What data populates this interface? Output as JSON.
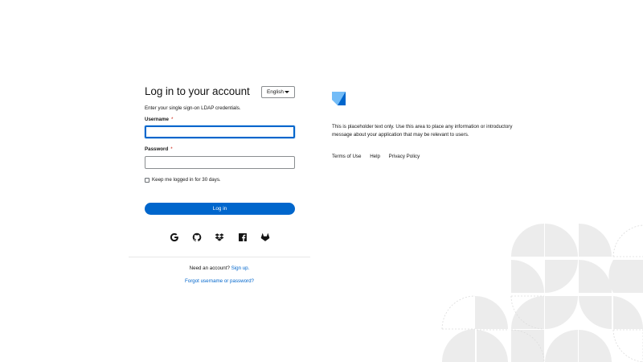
{
  "login": {
    "title": "Log in to your account",
    "language": "English",
    "subtitle": "Enter your single sign-on LDAP credentials.",
    "username_label": "Username",
    "password_label": "Password",
    "required_mark": "*",
    "username_value": "",
    "password_value": "",
    "keep_logged_in": "Keep me logged in for 30 days.",
    "keep_logged_in_checked": false,
    "login_button": "Log in",
    "social_icons": [
      "google-icon",
      "github-icon",
      "dropbox-icon",
      "facebook-icon",
      "gitlab-icon"
    ]
  },
  "footer": {
    "need_account": "Need an account?",
    "sign_up": "Sign up.",
    "forgot": "Forgot username or password?"
  },
  "info": {
    "logo_icon": "brand-logo-icon",
    "placeholder": "This is placeholder text only. Use this area to place any information or introductory message about your application that may be relevant to users.",
    "links": [
      "Terms of Use",
      "Help",
      "Privacy Policy"
    ]
  },
  "colors": {
    "primary": "#0066cc",
    "required": "#c9190b",
    "logo_light": "#73bcf7",
    "logo_dark": "#0066cc",
    "deco_fill": "#ececec"
  }
}
